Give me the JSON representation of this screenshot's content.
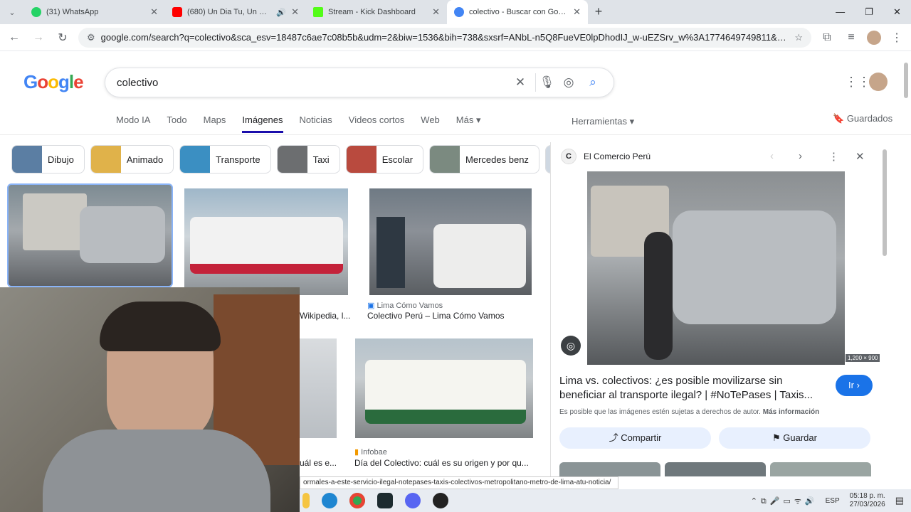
{
  "browser": {
    "tabs": [
      {
        "title": "(31) WhatsApp",
        "favicon_color": "#25d366"
      },
      {
        "title": "(680) Un Dia Tu, Un Dia Yo",
        "favicon_color": "#ff0000"
      },
      {
        "title": "Stream - Kick Dashboard",
        "favicon_color": "#53fc18"
      },
      {
        "title": "colectivo - Buscar con Google",
        "favicon_color": "#4285f4"
      }
    ],
    "url": "google.com/search?q=colectivo&sca_esv=18487c6ae7c08b5b&udm=2&biw=1536&bih=738&sxsrf=ANbL-n5Q8FueVE0lpDhodIJ_w-uEZSrv_w%3A1774649749811&ei=IQHHaauZMYLR1s..."
  },
  "google": {
    "logo": "Google",
    "query": "colectivo",
    "tabs": [
      "Modo IA",
      "Todo",
      "Maps",
      "Imágenes",
      "Noticias",
      "Videos cortos",
      "Web",
      "Más ▾"
    ],
    "active_tab": "Imágenes",
    "tools": "Herramientas ▾",
    "saved": "Guardados",
    "chips": [
      "Dibujo",
      "Animado",
      "Transporte",
      "Taxi",
      "Escolar",
      "Mercedes benz"
    ]
  },
  "results": [
    {
      "source": "Lima Cómo Vamos",
      "title": "Colectivo Perú – Lima Cómo Vamos"
    },
    {
      "source": "Infobae",
      "title": "Día del Colectivo: cuál es su origen y por qu..."
    },
    {
      "title_partial_1": "Wikipedia, l...",
      "title_partial_2": "uál es e..."
    }
  ],
  "panel": {
    "source": "El Comercio Perú",
    "dimensions": "1,200 × 900",
    "title": "Lima vs. colectivos: ¿es posible movilizarse sin beneficiar al transporte ilegal? | #NoTePases | Taxis...",
    "go": "Ir ›",
    "copyright": "Es posible que las imágenes estén sujetas a derechos de autor.",
    "more": "Más información",
    "share": "Compartir",
    "save": "Guardar"
  },
  "status_url": "ormales-a-este-servicio-ilegal-notepases-taxis-colectivos-metropolitano-metro-de-lima-atu-noticia/",
  "taskbar": {
    "lang": "ESP",
    "time": "05:18 p. m.",
    "date": "27/03/2026"
  },
  "colors": {
    "google_blue": "#1a73e8",
    "chip_border": "#dadce0"
  }
}
